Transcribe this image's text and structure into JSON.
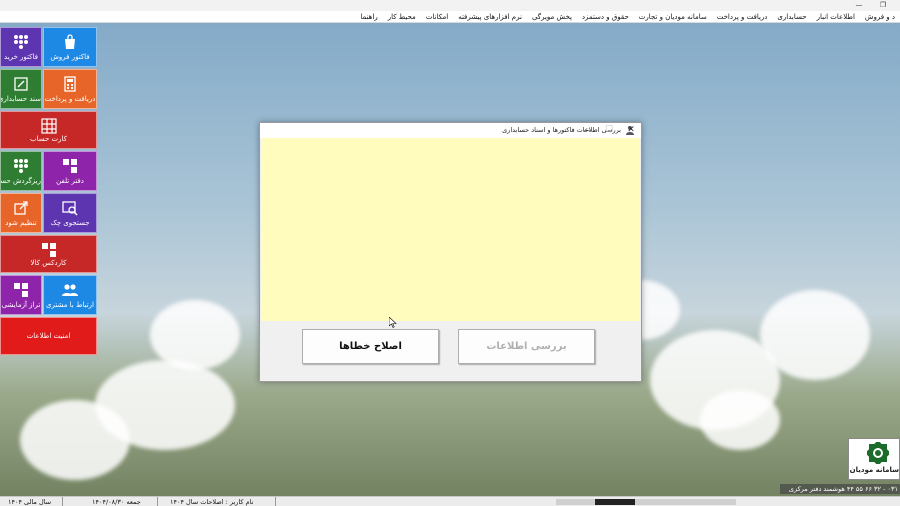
{
  "window": {
    "restore_glyph": "❐",
    "minimize_glyph": "—"
  },
  "menu": [
    "د و فروش",
    "اطلاعات انبار",
    "حسابداری",
    "دریافت و پرداخت",
    "سامانه مودیان و تجارت",
    "حقوق و دستمزد",
    "پخش مویرگی",
    "نرم افزارهای پیشرفته",
    "امکانات",
    "محیط کار",
    "راهنما"
  ],
  "tiles": {
    "purchase_invoice": "فاکتور خرید",
    "sales_invoice": "فاکتور فروش",
    "accounting_doc": "سند حسابداری",
    "receive_pay": "دریافت و پرداخت",
    "account_card": "کارت حساب",
    "ledger_detail": "ریزگردش حساب",
    "phonebook": "دفتر تلفن",
    "settlement": "تنظیم شود",
    "cheque_search": "جستجوی چک",
    "item_cardex": "کاردکس کالا",
    "trial_balance": "تراز آزمایشی",
    "customer_relation": "ارتباط با مشتری",
    "data_security": "امنیت اطلاعات"
  },
  "dialog": {
    "title": "بررسی اطلاعات فاکتورها و اسناد حسابداری",
    "minimize": "—",
    "maximize": "☐",
    "close": "✕",
    "fix_button": "اصلاح خطاها",
    "check_button": "بررسی اطلاعات"
  },
  "moodian": {
    "label": "سامانه مودیان"
  },
  "phone_text": "۰۳۱ - ۳۲ ۶۶ ۵۵ ۴۴  هوشمند دفتر مرکزی",
  "status": {
    "fiscal_year": "سال مالی ۱۴۰۴",
    "date": "جمعه  ۱۴۰۴/۰۸/۳۰",
    "user": "نام کاربر : اصلاحات سال ۱۴۰۴"
  },
  "colors": {
    "blue": "#1e88e5",
    "purple": "#5e35b1",
    "green": "#2e7d32",
    "orange": "#e8652a",
    "red": "#c62828",
    "violet": "#8e24aa"
  }
}
